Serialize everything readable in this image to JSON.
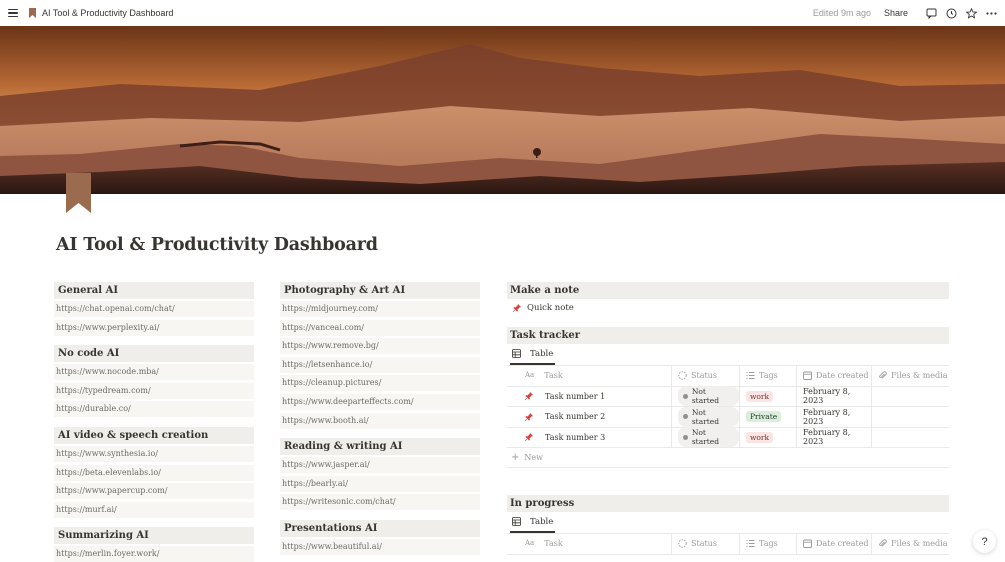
{
  "topbar": {
    "page_title": "AI Tool & Productivity Dashboard",
    "edited": "Edited 9m ago",
    "share": "Share",
    "icons": [
      "menu-icon",
      "bookmark-icon",
      "comment-icon",
      "clock-icon",
      "star-icon",
      "more-icon"
    ]
  },
  "page": {
    "title": "AI Tool & Productivity Dashboard",
    "icon": "bookmark-icon"
  },
  "col1": {
    "sections": [
      {
        "heading": "General AI",
        "links": [
          "https://chat.openai.com/chat/",
          "https://www.perplexity.ai/"
        ]
      },
      {
        "heading": "No code AI",
        "links": [
          "https://www.nocode.mba/",
          "https://typedream.com/",
          "https://durable.co/"
        ]
      },
      {
        "heading": "AI video & speech creation",
        "links": [
          "https://www.synthesia.io/",
          "https://beta.elevenlabs.io/",
          "https://www.papercup.com/",
          "https://murf.ai/"
        ]
      },
      {
        "heading": "Summarizing AI",
        "links": [
          "https://merlin.foyer.work/"
        ]
      }
    ]
  },
  "col2": {
    "sections": [
      {
        "heading": "Photography & Art AI",
        "links": [
          "https://midjourney.com/",
          "https://vanceai.com/",
          "https://www.remove.bg/",
          "https://letsenhance.io/",
          "https://cleanup.pictures/",
          "https://www.deeparteffects.com/",
          "https://www.booth.ai/"
        ]
      },
      {
        "heading": "Reading & writing AI",
        "links": [
          "https://www.jasper.ai/",
          "https://bearly.ai/",
          "https://writesonic.com/chat/"
        ]
      },
      {
        "heading": "Presentations AI",
        "links": [
          "https://www.beautiful.ai/"
        ]
      }
    ]
  },
  "note": {
    "heading": "Make a note",
    "item": "Quick note"
  },
  "tracker": {
    "heading": "Task tracker",
    "view": "Table",
    "columns": [
      "Task",
      "Status",
      "Tags",
      "Date created",
      "Files & media"
    ],
    "rows": [
      {
        "task": "Task number 1",
        "status": "Not started",
        "tag": "work",
        "date": "February 8, 2023"
      },
      {
        "task": "Task number 2",
        "status": "Not started",
        "tag": "Private",
        "date": "February 8, 2023"
      },
      {
        "task": "Task number 3",
        "status": "Not started",
        "tag": "work",
        "date": "February 8, 2023"
      }
    ],
    "new_label": "New"
  },
  "progress": {
    "heading": "In progress",
    "view": "Table",
    "columns": [
      "Task",
      "Status",
      "Tags",
      "Date created",
      "Files & media"
    ]
  },
  "help": "?",
  "colors": {
    "text": "#37352f",
    "muted": "#9b9a97",
    "heading_bg": "#f0eeeb",
    "link_bg": "#f7f6f3",
    "tag_work_bg": "#fbe4e4",
    "tag_private_bg": "#dbeddb"
  }
}
